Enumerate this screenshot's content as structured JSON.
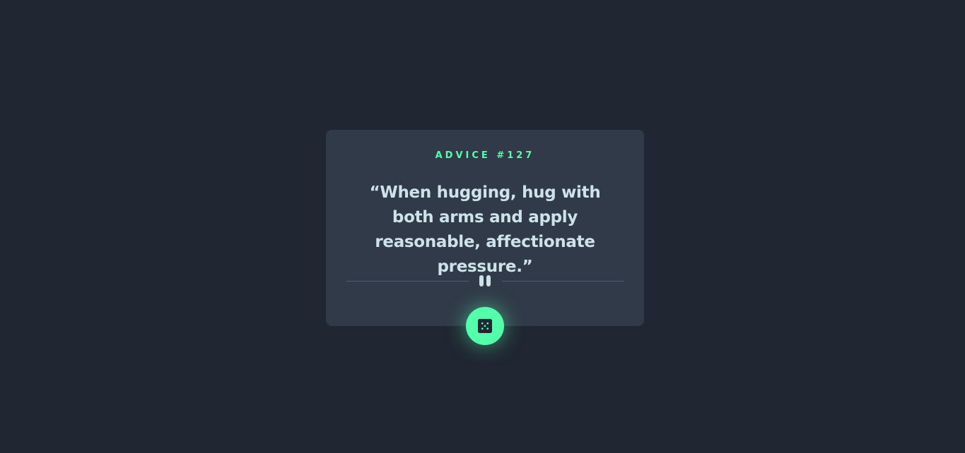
{
  "advice": {
    "label": "ADVICE #127",
    "text": "“When hugging, hug with both arms and apply reasonable, affectionate pressure.”"
  },
  "icons": {
    "divider": "pause-icon",
    "button": "dice-icon"
  },
  "colors": {
    "background": "#202632",
    "card": "#313A48",
    "accent": "#53FFAA",
    "text": "#CEE3E9",
    "divider": "#4F5D74"
  }
}
